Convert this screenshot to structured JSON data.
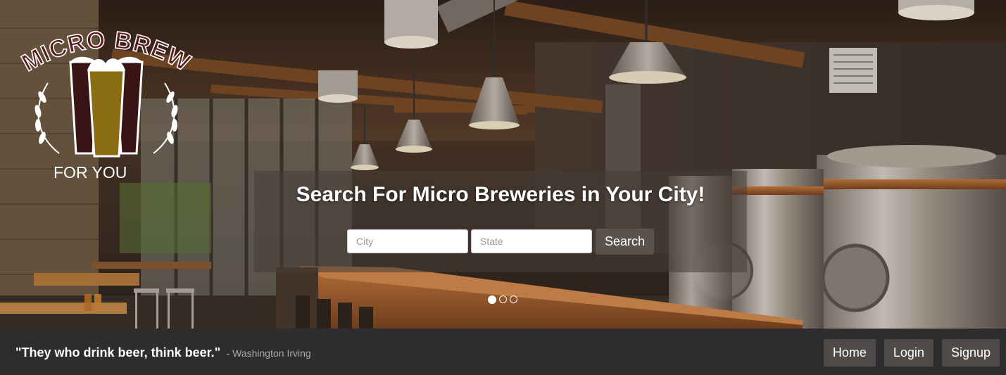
{
  "logo": {
    "arc_text": "MICRO BREW",
    "tagline": "FOR YOU",
    "icon": "beer-glasses-icon"
  },
  "hero": {
    "title": "Search For Micro Breweries in Your City!",
    "city_placeholder": "City",
    "state_placeholder": "State",
    "search_label": "Search",
    "slides": [
      {
        "active": true
      },
      {
        "active": false
      },
      {
        "active": false
      }
    ]
  },
  "footer": {
    "quote": "\"They who drink beer, think beer.\"",
    "author": "- Washington Irving",
    "nav": [
      {
        "label": "Home"
      },
      {
        "label": "Login"
      },
      {
        "label": "Signup"
      }
    ]
  },
  "colors": {
    "footer_bg": "#2d2c2e",
    "nav_button_bg": "#4d4a48",
    "search_button_bg": "#5a524d",
    "logo_maroon": "#5a1c1c",
    "logo_gold": "#8a6d12"
  }
}
